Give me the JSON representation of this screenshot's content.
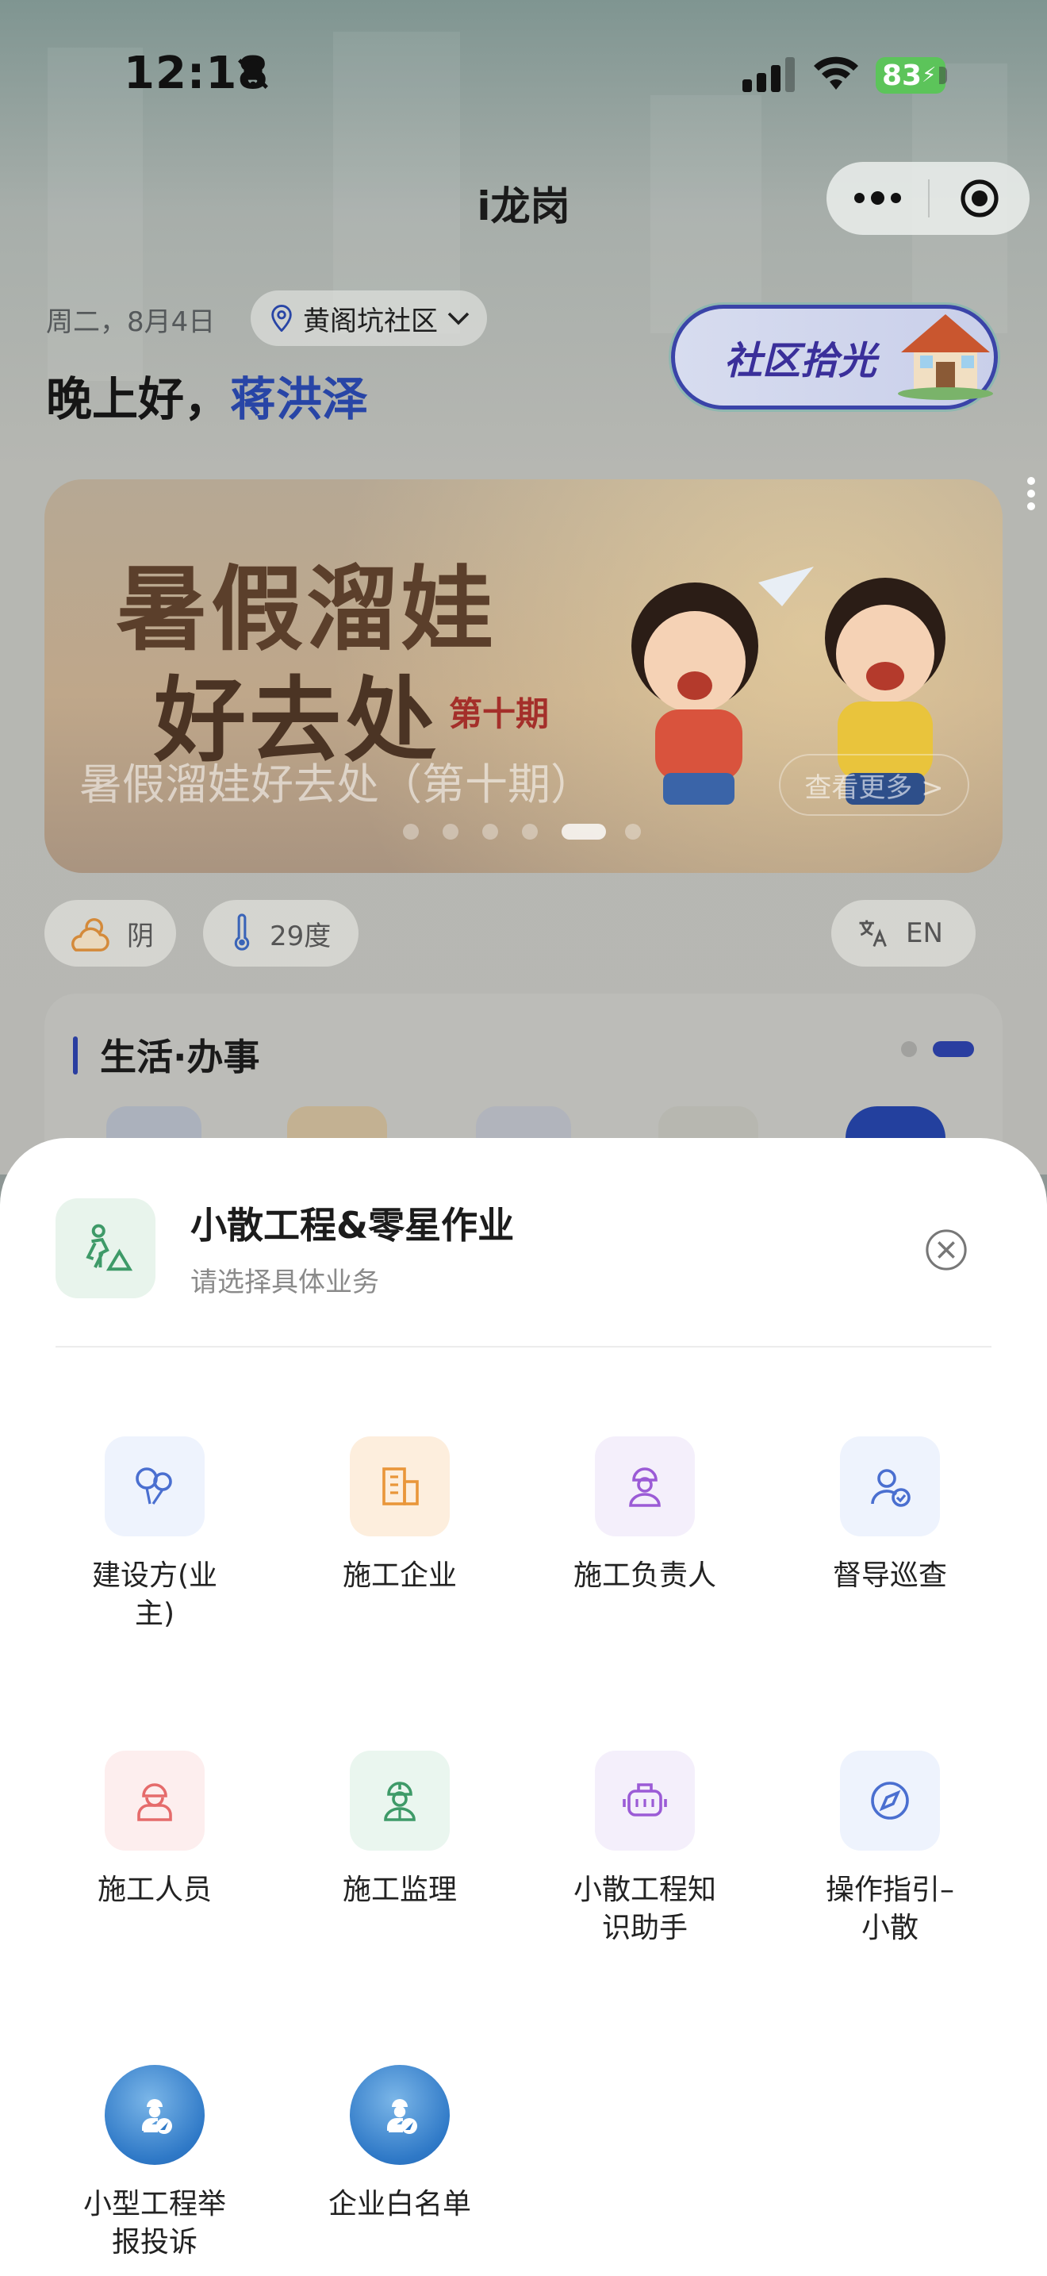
{
  "status_bar": {
    "time": "12:18",
    "battery": "83"
  },
  "app": {
    "title": "i龙岗"
  },
  "header": {
    "date": "周二，8月4日",
    "location": "黄阁坑社区",
    "greeting": "晚上好，",
    "user_name": "蒋洪泽",
    "community_light": "社区拾光"
  },
  "banner": {
    "art_line1": "暑假溜娃",
    "art_line2": "好去处",
    "art_issue": "第十期",
    "caption": "暑假溜娃好去处（第十期）",
    "more": "查看更多 >",
    "dots": 6,
    "active_dot": 4
  },
  "chips": {
    "weather": "阴",
    "temperature": "29度",
    "language": "EN"
  },
  "life_section": {
    "title": "生活·办事"
  },
  "sheet": {
    "title": "小散工程&零星作业",
    "subtitle": "请选择具体业务",
    "items": [
      {
        "label": "建设方(业主)",
        "icon": "balloons-icon",
        "color": "#4a6fd0",
        "bg": "#eef3fd"
      },
      {
        "label": "施工企业",
        "icon": "building-icon",
        "color": "#e9963a",
        "bg": "#fdeedd"
      },
      {
        "label": "施工负责人",
        "icon": "worker-helmet-icon",
        "color": "#9b5bd6",
        "bg": "#f4effb"
      },
      {
        "label": "督导巡查",
        "icon": "user-check-icon",
        "color": "#4a6fd0",
        "bg": "#eef3fd"
      },
      {
        "label": "施工人员",
        "icon": "construction-worker-icon",
        "color": "#e56b6b",
        "bg": "#fdeeee"
      },
      {
        "label": "施工监理",
        "icon": "supervisor-icon",
        "color": "#3e9a68",
        "bg": "#eaf6ef"
      },
      {
        "label": "小散工程知识助手",
        "icon": "robot-icon",
        "color": "#9b5bd6",
        "bg": "#f4effb"
      },
      {
        "label": "操作指引–小散",
        "icon": "compass-icon",
        "color": "#4a6fd0",
        "bg": "#eef3fd"
      },
      {
        "label": "小型工程举报投诉",
        "icon": "officer-avatar-icon",
        "color": "#2f79c7",
        "bg": "round"
      },
      {
        "label": "企业白名单",
        "icon": "officer-avatar-icon",
        "color": "#2f79c7",
        "bg": "round"
      }
    ]
  }
}
